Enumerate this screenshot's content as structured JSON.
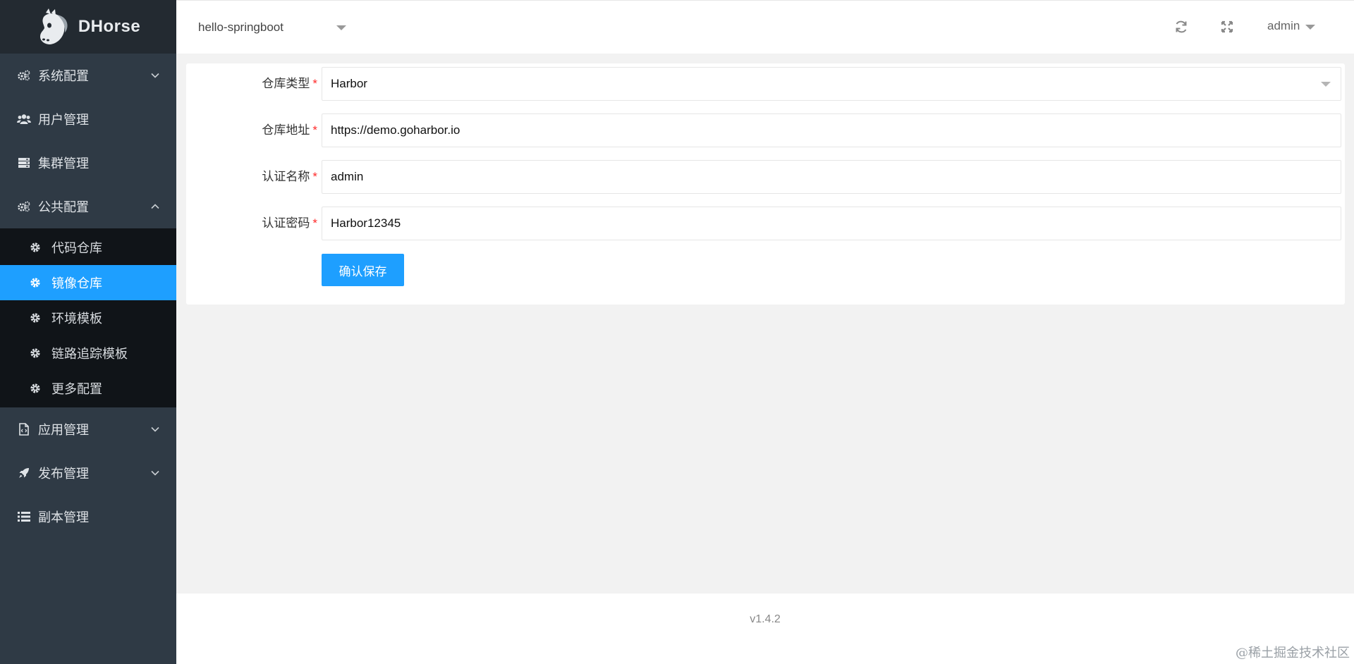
{
  "brand": {
    "name": "DHorse"
  },
  "sidebar": {
    "items": [
      {
        "label": "系统配置",
        "icon": "cogs-icon",
        "expandable": true,
        "expanded": false
      },
      {
        "label": "用户管理",
        "icon": "users-icon",
        "expandable": false
      },
      {
        "label": "集群管理",
        "icon": "server-icon",
        "expandable": false
      },
      {
        "label": "公共配置",
        "icon": "cogs-icon",
        "expandable": true,
        "expanded": true
      },
      {
        "label": "应用管理",
        "icon": "file-code-icon",
        "expandable": true,
        "expanded": false
      },
      {
        "label": "发布管理",
        "icon": "rocket-icon",
        "expandable": true,
        "expanded": false
      },
      {
        "label": "副本管理",
        "icon": "list-icon",
        "expandable": false
      }
    ],
    "public_config_children": [
      {
        "label": "代码仓库",
        "icon": "gear-icon",
        "active": false
      },
      {
        "label": "镜像仓库",
        "icon": "gear-icon",
        "active": true
      },
      {
        "label": "环境模板",
        "icon": "gear-icon",
        "active": false
      },
      {
        "label": "链路追踪模板",
        "icon": "gear-icon",
        "active": false
      },
      {
        "label": "更多配置",
        "icon": "gear-icon",
        "active": false
      }
    ]
  },
  "header": {
    "app_selected": "hello-springboot",
    "user": "admin",
    "icons": [
      "refresh-icon",
      "fullscreen-icon"
    ]
  },
  "form": {
    "fields": [
      {
        "label": "仓库类型",
        "value": "Harbor",
        "type": "select",
        "required": true
      },
      {
        "label": "仓库地址",
        "value": "https://demo.goharbor.io",
        "type": "text",
        "required": true
      },
      {
        "label": "认证名称",
        "value": "admin",
        "type": "text",
        "required": true
      },
      {
        "label": "认证密码",
        "value": "Harbor12345",
        "type": "text",
        "required": true
      }
    ],
    "submit_label": "确认保存",
    "required_mark": "*"
  },
  "footer": {
    "version": "v1.4.2"
  },
  "watermark": "@稀土掘金技术社区",
  "colors": {
    "sidebar_bg": "#2f3a45",
    "sidebar_dark": "#232a31",
    "submenu_bg": "#101418",
    "accent": "#1e9fff",
    "required": "#ff2a2a"
  }
}
